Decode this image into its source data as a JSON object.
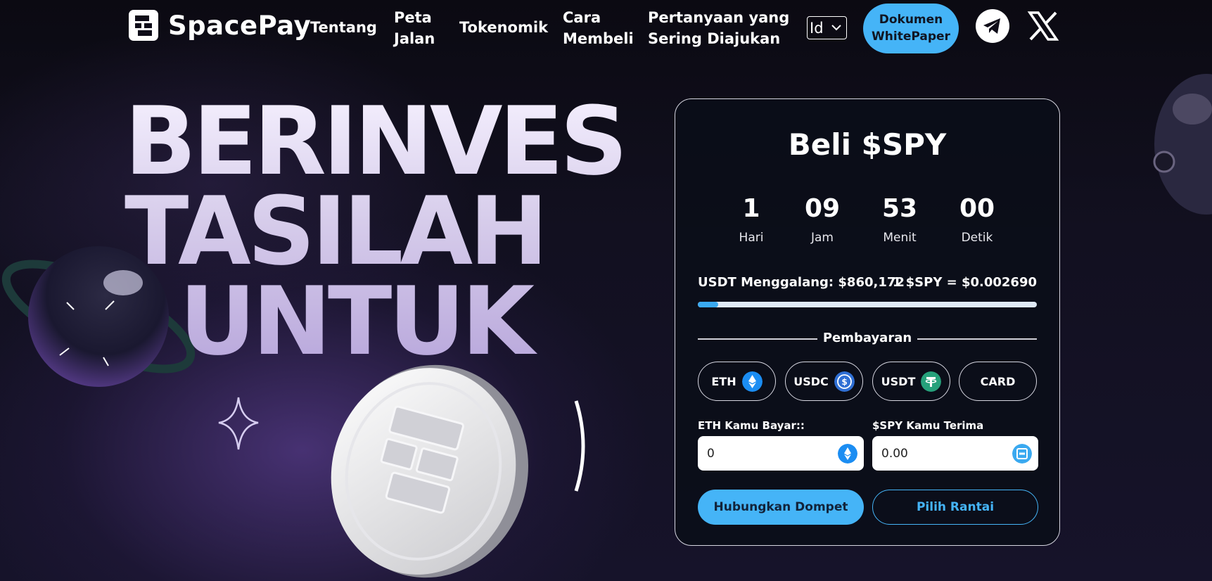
{
  "brand": {
    "name": "SpacePay"
  },
  "nav": {
    "items": [
      {
        "label_1": "Tentang",
        "label_2": ""
      },
      {
        "label_1": "Peta",
        "label_2": "Jalan"
      },
      {
        "label_1": "Tokenomik",
        "label_2": ""
      },
      {
        "label_1": "Cara",
        "label_2": "Membeli"
      },
      {
        "label_1": "Pertanyaan yang",
        "label_2": "Sering Diajukan"
      }
    ],
    "language": "Id",
    "doc_button": {
      "line1": "Dokumen",
      "line2": "WhitePaper"
    },
    "social": [
      "telegram-icon",
      "x-icon"
    ]
  },
  "hero": {
    "line1": "BERINVES",
    "line2": "TASILAH",
    "line3": "UNTUK"
  },
  "buy": {
    "title": "Beli $SPY",
    "countdown": [
      {
        "value": "1",
        "label": "Hari"
      },
      {
        "value": "09",
        "label": "Jam"
      },
      {
        "value": "53",
        "label": "Menit"
      },
      {
        "value": "00",
        "label": "Detik"
      }
    ],
    "raised": "USDT Menggalang: $860,172",
    "price": "1 $SPY = $0.002690",
    "progress_fraction": 0.06,
    "payment_heading": "Pembayaran",
    "payment_methods": [
      {
        "label": "ETH",
        "icon": "eth-icon",
        "color": "#1b8df2"
      },
      {
        "label": "USDC",
        "icon": "usdc-icon",
        "color": "#2f6fd4"
      },
      {
        "label": "USDT",
        "icon": "usdt-icon",
        "color": "#26a17b"
      },
      {
        "label": "CARD",
        "icon": "",
        "color": ""
      }
    ],
    "pay_field": {
      "label": "ETH Kamu Bayar::",
      "value": "0"
    },
    "receive_field": {
      "label": "$SPY Kamu Terima",
      "value": "0.00"
    },
    "connect_button": "Hubungkan Dompet",
    "chain_button": "Pilih Rantai"
  },
  "colors": {
    "accent": "#45b4f7",
    "background": "#0e0c18"
  }
}
